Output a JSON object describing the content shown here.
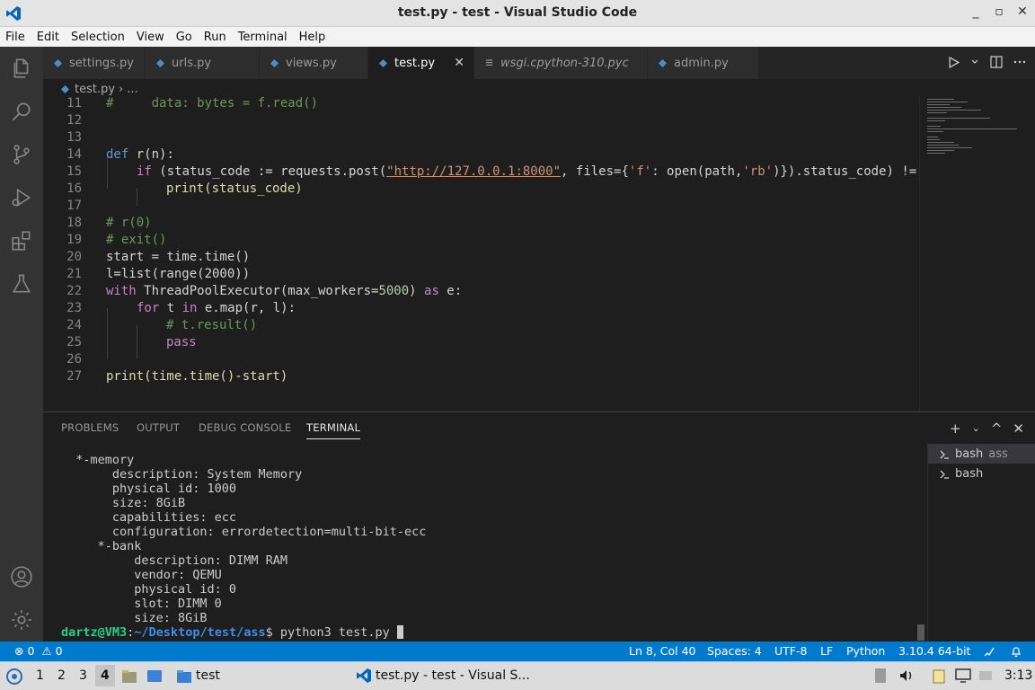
{
  "window": {
    "title": "test.py - test - Visual Studio Code",
    "controls": [
      "_",
      "▫",
      "✕"
    ]
  },
  "menu": [
    "File",
    "Edit",
    "Selection",
    "View",
    "Go",
    "Run",
    "Terminal",
    "Help"
  ],
  "tabs": [
    {
      "label": "settings.py",
      "italic": false,
      "active": false
    },
    {
      "label": "urls.py",
      "italic": false,
      "active": false
    },
    {
      "label": "views.py",
      "italic": false,
      "active": false
    },
    {
      "label": "test.py",
      "italic": false,
      "active": true,
      "close": "✕"
    },
    {
      "label": "wsgi.cpython-310.pyc",
      "italic": true,
      "active": false
    },
    {
      "label": "admin.py",
      "italic": false,
      "active": false
    }
  ],
  "breadcrumb": {
    "file": "test.py",
    "rest": "..."
  },
  "editor": {
    "line_numbers": [
      "11",
      "12",
      "13",
      "14",
      "15",
      "16",
      "17",
      "18",
      "19",
      "20",
      "21",
      "22",
      "23",
      "24",
      "25",
      "26",
      "27"
    ],
    "code": {
      "l11": "#     data: bytes = f.read()",
      "l14_def": "def",
      "l14_name": "r",
      "l14_rest": "(n):",
      "l15_if": "if",
      "l15_a": " (status_code := requests.post(",
      "l15_url": "\"http://127.0.0.1:8000\"",
      "l15_b": ", files={",
      "l15_c": "'f'",
      "l15_d": ": open(path,",
      "l15_e": "'rb'",
      "l15_f": ")}).status_code) !=",
      "l16": "print(status_code)",
      "l18": "# r(0)",
      "l19": "# exit()",
      "l20": "start = time.time()",
      "l21": "l=list(range(2000))",
      "l22_with": "with",
      "l22_a": " ThreadPoolExecutor(max_workers=",
      "l22_num": "5000",
      "l22_b": ") ",
      "l22_as": "as",
      "l22_c": " e:",
      "l23_for": "for",
      "l23_a": " t ",
      "l23_in": "in",
      "l23_b": " e.map(r, l):",
      "l24": "# t.result()",
      "l25": "pass",
      "l27": "print(time.time()-start)"
    }
  },
  "panel": {
    "tabs": [
      "PROBLEMS",
      "OUTPUT",
      "DEBUG CONSOLE",
      "TERMINAL"
    ],
    "active_tab": "TERMINAL",
    "actions": [
      "+",
      "⌄",
      "^",
      "✕"
    ]
  },
  "terminal": {
    "lines": [
      "  *-memory",
      "       description: System Memory",
      "       physical id: 1000",
      "       size: 8GiB",
      "       capabilities: ecc",
      "       configuration: errordetection=multi-bit-ecc",
      "     *-bank",
      "          description: DIMM RAM",
      "          vendor: QEMU",
      "          physical id: 0",
      "          slot: DIMM 0",
      "          size: 8GiB"
    ],
    "prompt_user": "dartz@VM3",
    "prompt_sep": ":",
    "prompt_path": "~/Desktop/test/ass",
    "prompt_symbol": "$",
    "command": " python3 test.py "
  },
  "terminal_list": [
    {
      "name": "bash",
      "extra": "ass",
      "active": true
    },
    {
      "name": "bash",
      "extra": "",
      "active": false
    }
  ],
  "status": {
    "errors": "0",
    "warnings": "0",
    "position": "Ln 8, Col 40",
    "spaces": "Spaces: 4",
    "encoding": "UTF-8",
    "eol": "LF",
    "language": "Python",
    "interpreter": "3.10.4 64-bit"
  },
  "taskbar": {
    "workspaces": [
      "1",
      "2",
      "3",
      "4"
    ],
    "folder": "test",
    "window": "test.py - test - Visual S...",
    "time": "3:13"
  },
  "colors": {
    "accent": "#007acc",
    "activity": "#333333",
    "editor_bg": "#1e1e1e"
  }
}
